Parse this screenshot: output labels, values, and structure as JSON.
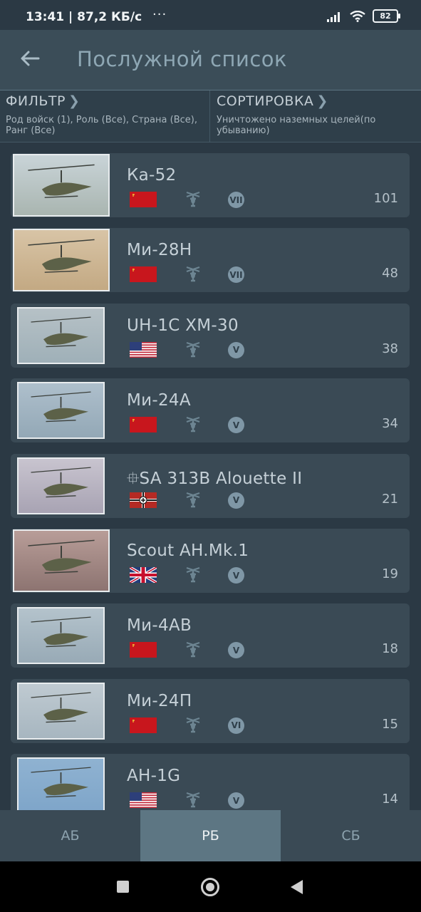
{
  "statusbar": {
    "time": "13:41 | 87,2 КБ/с",
    "dots": "···",
    "battery": "82"
  },
  "header": {
    "title": "Послужной список"
  },
  "filter": {
    "label": "ФИЛЬТР",
    "value": "Род войск (1), Роль (Все), Страна (Все), Ранг (Все)"
  },
  "sort": {
    "label": "СОРТИРОВКА",
    "value": "Уничтожено наземных целей(по убыванию)"
  },
  "items": [
    {
      "name": "Ка-52",
      "country": "ussr",
      "rank": "VII",
      "count": "101"
    },
    {
      "name": "Ми-28Н",
      "country": "ussr",
      "rank": "VII",
      "count": "48"
    },
    {
      "name": "UH-1C XM-30",
      "country": "usa",
      "rank": "V",
      "count": "38"
    },
    {
      "name": "Ми-24А",
      "country": "ussr",
      "rank": "V",
      "count": "34"
    },
    {
      "name": "⯐SA 313B Alouette II",
      "country": "germany",
      "rank": "V",
      "count": "21"
    },
    {
      "name": "Scout AH.Mk.1",
      "country": "uk",
      "rank": "V",
      "count": "19"
    },
    {
      "name": "Ми-4АВ",
      "country": "ussr",
      "rank": "V",
      "count": "18"
    },
    {
      "name": "Ми-24П",
      "country": "ussr",
      "rank": "VI",
      "count": "15"
    },
    {
      "name": "AH-1G",
      "country": "usa",
      "rank": "V",
      "count": "14"
    }
  ],
  "tabs": [
    {
      "label": "АБ",
      "active": false
    },
    {
      "label": "РБ",
      "active": true
    },
    {
      "label": "СБ",
      "active": false
    }
  ],
  "colors": {
    "background": "#2b3944",
    "row": "#3a4a55",
    "tab_active": "#5d7683"
  }
}
